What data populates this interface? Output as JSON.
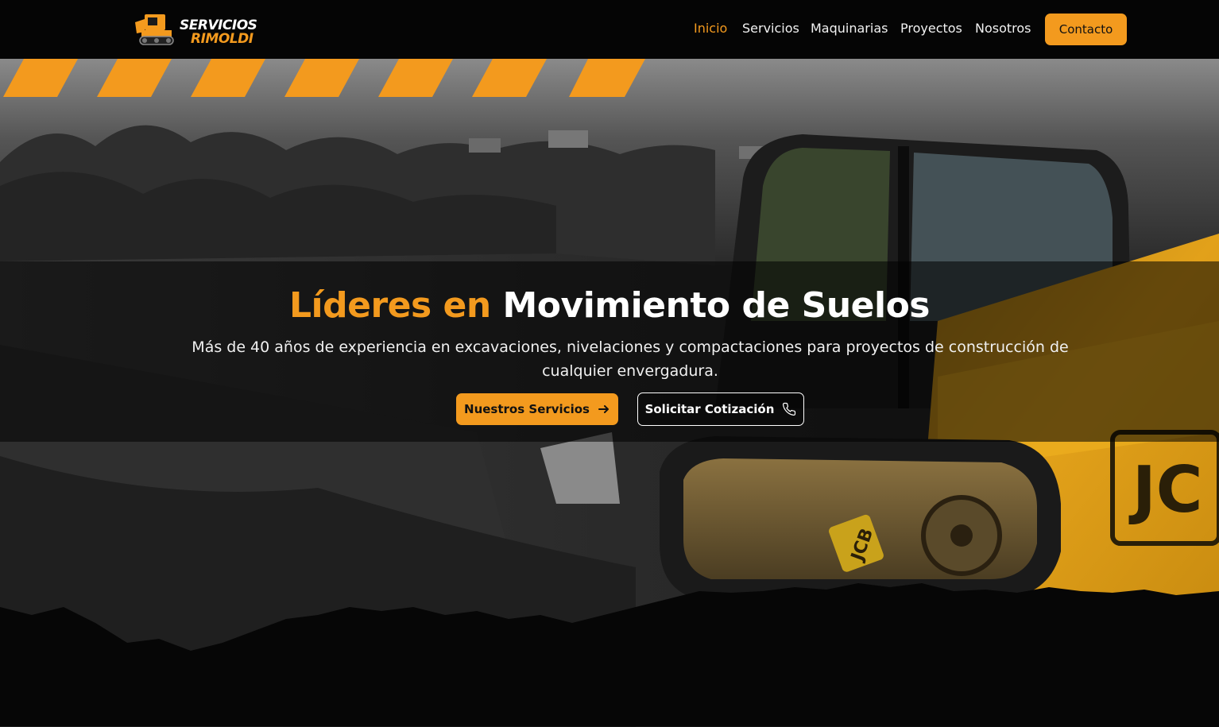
{
  "brand": {
    "line1": "SERVICIOS",
    "line2": "RIMOLDI",
    "logo_icon": "skid-steer-loader-icon"
  },
  "nav": {
    "items": [
      {
        "label": "Inicio",
        "active": true
      },
      {
        "label": "Servicios",
        "active": false
      },
      {
        "label": "Maquinarias",
        "active": false
      },
      {
        "label": "Proyectos",
        "active": false
      },
      {
        "label": "Nosotros",
        "active": false
      }
    ],
    "contact_label": "Contacto"
  },
  "hero": {
    "title_accent": "Líderes en",
    "title_rest": "Movimiento de Suelos",
    "subtitle": "Más de 40 años de experiencia en excavaciones, nivelaciones y compactaciones para proyectos de construcción de cualquier envergadura.",
    "primary_button": "Nuestros Servicios",
    "primary_icon": "arrow-right-icon",
    "secondary_button": "Solicitar Cotización",
    "secondary_icon": "phone-icon",
    "background": "excavator-jcb-photo"
  },
  "colors": {
    "accent": "#f39a1e",
    "navbar_bg": "#050505",
    "hero_bottom": "#060606",
    "machine_yellow": "#e8a417"
  }
}
